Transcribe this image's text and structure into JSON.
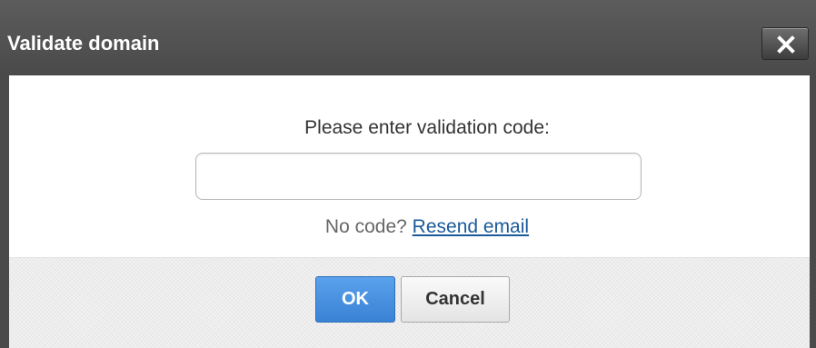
{
  "dialog": {
    "title": "Validate domain",
    "close_icon": "close-icon"
  },
  "body": {
    "prompt": "Please enter validation code:",
    "code_input": {
      "value": "",
      "placeholder": ""
    },
    "no_code_text": "No code?",
    "resend_link": "Resend email"
  },
  "footer": {
    "ok_label": "OK",
    "cancel_label": "Cancel"
  },
  "colors": {
    "titlebar": "#4f4f4f",
    "ok_button": "#3d88d8",
    "link": "#1a5a9a"
  }
}
